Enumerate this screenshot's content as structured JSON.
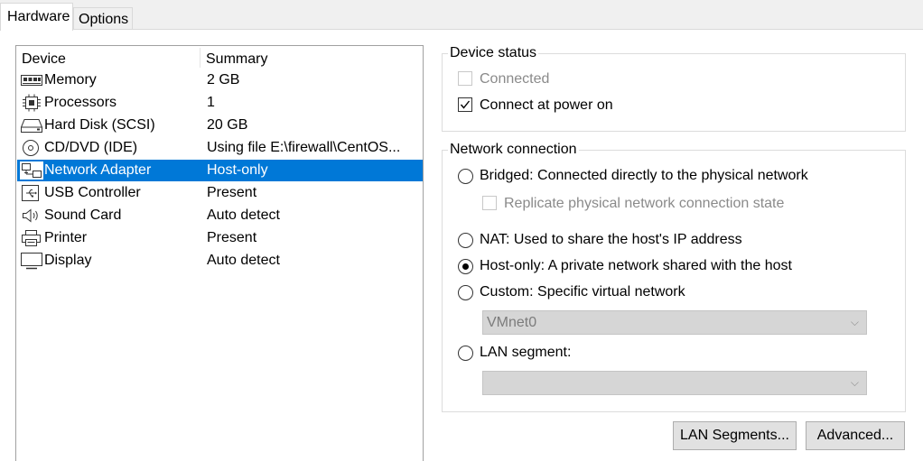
{
  "tabs": [
    {
      "label": "Hardware",
      "active": true
    },
    {
      "label": "Options",
      "active": false
    }
  ],
  "device_list": {
    "headers": {
      "device": "Device",
      "summary": "Summary"
    },
    "rows": [
      {
        "icon": "memory-icon",
        "device": "Memory",
        "summary": "2 GB",
        "selected": false
      },
      {
        "icon": "processor-icon",
        "device": "Processors",
        "summary": "1",
        "selected": false
      },
      {
        "icon": "hard-disk-icon",
        "device": "Hard Disk (SCSI)",
        "summary": "20 GB",
        "selected": false
      },
      {
        "icon": "cd-dvd-icon",
        "device": "CD/DVD (IDE)",
        "summary": "Using file E:\\firewall\\CentOS...",
        "selected": false
      },
      {
        "icon": "network-adapter-icon",
        "device": "Network Adapter",
        "summary": "Host-only",
        "selected": true
      },
      {
        "icon": "usb-icon",
        "device": "USB Controller",
        "summary": "Present",
        "selected": false
      },
      {
        "icon": "speaker-icon",
        "device": "Sound Card",
        "summary": "Auto detect",
        "selected": false
      },
      {
        "icon": "printer-icon",
        "device": "Printer",
        "summary": "Present",
        "selected": false
      },
      {
        "icon": "display-icon",
        "device": "Display",
        "summary": "Auto detect",
        "selected": false
      }
    ]
  },
  "device_status": {
    "title": "Device status",
    "connected": {
      "label": "Connected",
      "checked": false,
      "enabled": false
    },
    "connect_at_power_on": {
      "label": "Connect at power on",
      "checked": true,
      "enabled": true
    }
  },
  "network_connection": {
    "title": "Network connection",
    "bridged": {
      "label": "Bridged: Connected directly to the physical network",
      "selected": false
    },
    "replicate": {
      "label": "Replicate physical network connection state",
      "checked": false,
      "enabled": false
    },
    "nat": {
      "label": "NAT: Used to share the host's IP address",
      "selected": false
    },
    "host_only": {
      "label": "Host-only: A private network shared with the host",
      "selected": true
    },
    "custom": {
      "label": "Custom: Specific virtual network",
      "selected": false
    },
    "custom_network": {
      "value": "VMnet0",
      "enabled": false
    },
    "lan_segment": {
      "label": "LAN segment:",
      "selected": false
    },
    "lan_segment_value": {
      "value": "",
      "enabled": false
    }
  },
  "buttons": {
    "lan_segments": "LAN Segments...",
    "advanced": "Advanced..."
  },
  "colors": {
    "selection": "#0078d7",
    "disabled_text": "#8a8a8a",
    "button_face": "#e1e1e1"
  }
}
